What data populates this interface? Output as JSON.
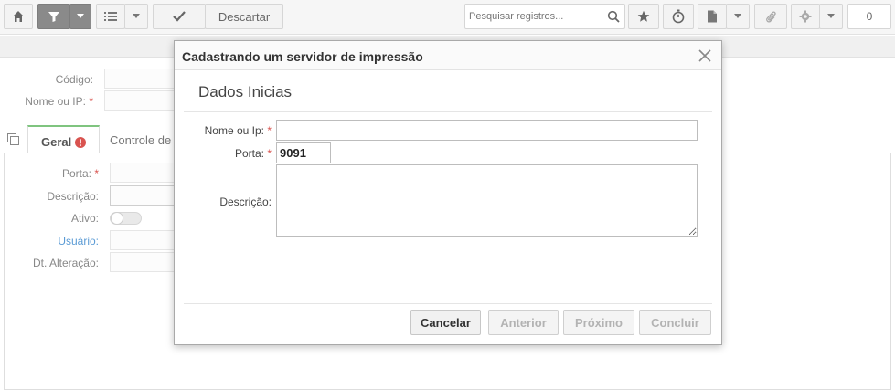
{
  "toolbar": {
    "discard_label": "Descartar",
    "search_placeholder": "Pesquisar registros...",
    "counter": "0"
  },
  "form": {
    "codigo_label": "Código:",
    "nome_ip_label": "Nome ou IP:",
    "required_mark": "*",
    "tabs": [
      {
        "label": "Geral",
        "active": true,
        "has_error": true
      },
      {
        "label": "Controle de"
      }
    ],
    "fields": {
      "porta_label": "Porta:",
      "descricao_label": "Descrição:",
      "ativo_label": "Ativo:",
      "usuario_label": "Usuário:",
      "dt_alteracao_label": "Dt. Alteração:"
    }
  },
  "modal": {
    "title": "Cadastrando um servidor de impressão",
    "section_title": "Dados Inicias",
    "nome_ip_label": "Nome ou Ip:",
    "nome_ip_value": "",
    "porta_label": "Porta:",
    "porta_value": "9091",
    "descricao_label": "Descrição:",
    "descricao_value": "",
    "required_mark": "*",
    "buttons": {
      "cancel": "Cancelar",
      "previous": "Anterior",
      "next": "Próximo",
      "finish": "Concluir"
    }
  },
  "colors": {
    "required": "#d9534f",
    "link": "#5b9bd5",
    "active_tab": "#7fc47f",
    "filter_button": "#8a8a8a"
  }
}
